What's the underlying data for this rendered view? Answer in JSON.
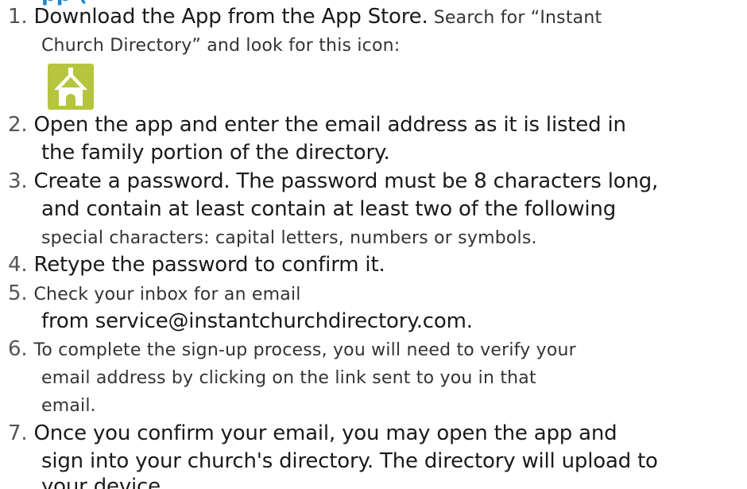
{
  "heading_fragment": "pp (",
  "steps": [
    {
      "number": "1.",
      "lines": [
        [
          "Download the App from the App Store.",
          "  Search for “Instant"
        ],
        [
          "Church Directory” and look for this icon:"
        ]
      ]
    },
    {
      "number": "2.",
      "lines": [
        [
          "Open the app and enter the email address as it is listed in"
        ],
        [
          "the family portion of the directory."
        ]
      ]
    },
    {
      "number": "3.",
      "lines": [
        [
          "Create a password. The password must be 8 characters long,"
        ],
        [
          "and contain at least contain at least two of the following"
        ],
        [
          "special characters: capital letters, numbers or symbols."
        ]
      ]
    },
    {
      "number": "4.",
      "lines": [
        [
          "Retype the password to confirm it."
        ]
      ]
    },
    {
      "number": "5.",
      "lines": [
        [
          "Check your inbox for an email"
        ],
        [
          "from service@instantchurchdirectory.com."
        ]
      ]
    },
    {
      "number": "6.",
      "lines": [
        [
          "To complete the sign-up process, you will need to verify your"
        ],
        [
          "email address by clicking on the link sent to you in that"
        ],
        [
          "email."
        ]
      ]
    },
    {
      "number": "7.",
      "lines": [
        [
          "Once you confirm your email, you may open the app and"
        ],
        [
          "sign into your church's directory. The directory will upload to"
        ],
        [
          "your device."
        ]
      ]
    }
  ],
  "colors": {
    "icon_background": "#b5c63e",
    "heading": "#1f86c8"
  },
  "icons": {
    "app_icon": "church-house-icon"
  }
}
